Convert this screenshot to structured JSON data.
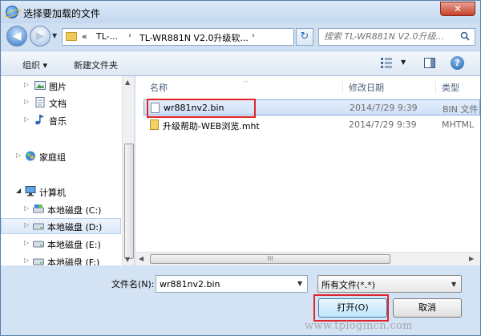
{
  "window": {
    "title": "选择要加载的文件",
    "close_glyph": "✕"
  },
  "address": {
    "crumbs": [
      "«",
      "TL-...",
      "›",
      "TL-WR881N V2.0升级软...",
      ""
    ],
    "search_placeholder": "搜索 TL-WR881N V2.0升级..."
  },
  "toolbar": {
    "organize": "组织 ▾",
    "new_folder": "新建文件夹",
    "help": "?"
  },
  "nav": {
    "items": [
      {
        "label": "图片",
        "icon": "pictures-icon"
      },
      {
        "label": "文档",
        "icon": "documents-icon"
      },
      {
        "label": "音乐",
        "icon": "music-icon"
      },
      {
        "label": "家庭组",
        "icon": "homegroup-icon"
      },
      {
        "label": "计算机",
        "icon": "computer-icon"
      },
      {
        "label": "本地磁盘 (C:)",
        "icon": "drive-icon"
      },
      {
        "label": "本地磁盘 (D:)",
        "icon": "drive-icon",
        "selected": true
      },
      {
        "label": "本地磁盘 (E:)",
        "icon": "drive-icon"
      },
      {
        "label": "本地磁盘 (F:)",
        "icon": "drive-icon"
      }
    ]
  },
  "files": {
    "columns": [
      "名称",
      "修改日期",
      "类型"
    ],
    "rows": [
      {
        "name": "wr881nv2.bin",
        "date": "2014/7/29 9:39",
        "type": "BIN 文件",
        "selected": true
      },
      {
        "name": "升级帮助-WEB浏览.mht",
        "date": "2014/7/29 9:39",
        "type": "MHTML"
      }
    ],
    "hscroll_grip": "III"
  },
  "bottom": {
    "filename_label": "文件名(N):",
    "filename_value": "wr881nv2.bin",
    "filetype_value": "所有文件(*.*)",
    "open_label": "打开(O)",
    "cancel_label": "取消"
  },
  "watermark": "www.tplogincn.com"
}
